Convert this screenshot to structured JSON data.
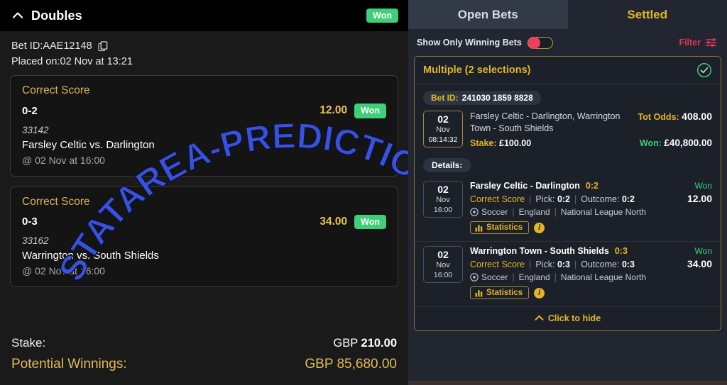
{
  "left_panel": {
    "header": {
      "collapse_icon": "chevron-up-icon",
      "title": "Doubles",
      "status_badge": "Won"
    },
    "meta": {
      "bet_id": "Bet ID:AAE12148",
      "copy_icon": "copy-icon",
      "placed_on": "Placed on:02 Nov at 13:21"
    },
    "bets": [
      {
        "market": "Correct Score",
        "pick": "0-2",
        "odds": "12.00",
        "status": "Won",
        "event_id": "33142",
        "teams": "Farsley Celtic vs. Darlington",
        "kickoff": "@ 02 Nov at 16:00"
      },
      {
        "market": "Correct Score",
        "pick": "0-3",
        "odds": "34.00",
        "status": "Won",
        "event_id": "33162",
        "teams": "Warrington vs. South Shields",
        "kickoff": "@ 02 Nov at 16:00"
      }
    ],
    "footer": {
      "stake_label": "Stake:",
      "stake_currency": "GBP",
      "stake_value": "210.00",
      "winnings_label": "Potential Winnings:",
      "winnings_value": "GBP 85,680.00"
    }
  },
  "watermark": {
    "text": "STATAREA-PREDICTIONS.COM",
    "color": "#3a56e8"
  },
  "right_panel": {
    "tabs": [
      {
        "label": "Open Bets",
        "active": false
      },
      {
        "label": "Settled",
        "active": true
      }
    ],
    "filter_bar": {
      "toggle_label": "Show Only Winning Bets",
      "toggle_state": "off",
      "toggle_color": "#ec3f5e",
      "filter_label": "Filter",
      "filter_icon": "sliders-icon"
    },
    "multiple_card": {
      "title": "Multiple (2 selections)",
      "status_icon": "check-circle-icon",
      "bet_id_label": "Bet ID:",
      "bet_id_value": "241030 1859 8828",
      "summary": {
        "date_day": "02",
        "date_month": "Nov",
        "date_time": "08:14:32",
        "events": "Farsley Celtic - Darlington, Warrington Town - South Shields",
        "tot_odds_label": "Tot Odds:",
        "tot_odds_value": "408.00",
        "stake_label": "Stake:",
        "stake_value": "£100.00",
        "won_label": "Won:",
        "won_value": "£40,800.00"
      },
      "details_label": "Details:",
      "selections": [
        {
          "date_day": "02",
          "date_month": "Nov",
          "date_time": "16:00",
          "match": "Farsley Celtic - Darlington",
          "score": "0:2",
          "status": "Won",
          "market": "Correct Score",
          "pick_label": "Pick:",
          "pick_value": "0:2",
          "outcome_label": "Outcome:",
          "outcome_value": "0:2",
          "odds": "12.00",
          "sport": "Soccer",
          "country": "England",
          "league": "National League North",
          "stats_label": "Statistics",
          "info_label": "i"
        },
        {
          "date_day": "02",
          "date_month": "Nov",
          "date_time": "16:00",
          "match": "Warrington Town - South Shields",
          "score": "0:3",
          "status": "Won",
          "market": "Correct Score",
          "pick_label": "Pick:",
          "pick_value": "0:3",
          "outcome_label": "Outcome:",
          "outcome_value": "0:3",
          "odds": "34.00",
          "sport": "Soccer",
          "country": "England",
          "league": "National League North",
          "stats_label": "Statistics",
          "info_label": "i"
        }
      ],
      "footer_label": "Click to hide",
      "footer_icon": "chevron-up-icon"
    }
  }
}
